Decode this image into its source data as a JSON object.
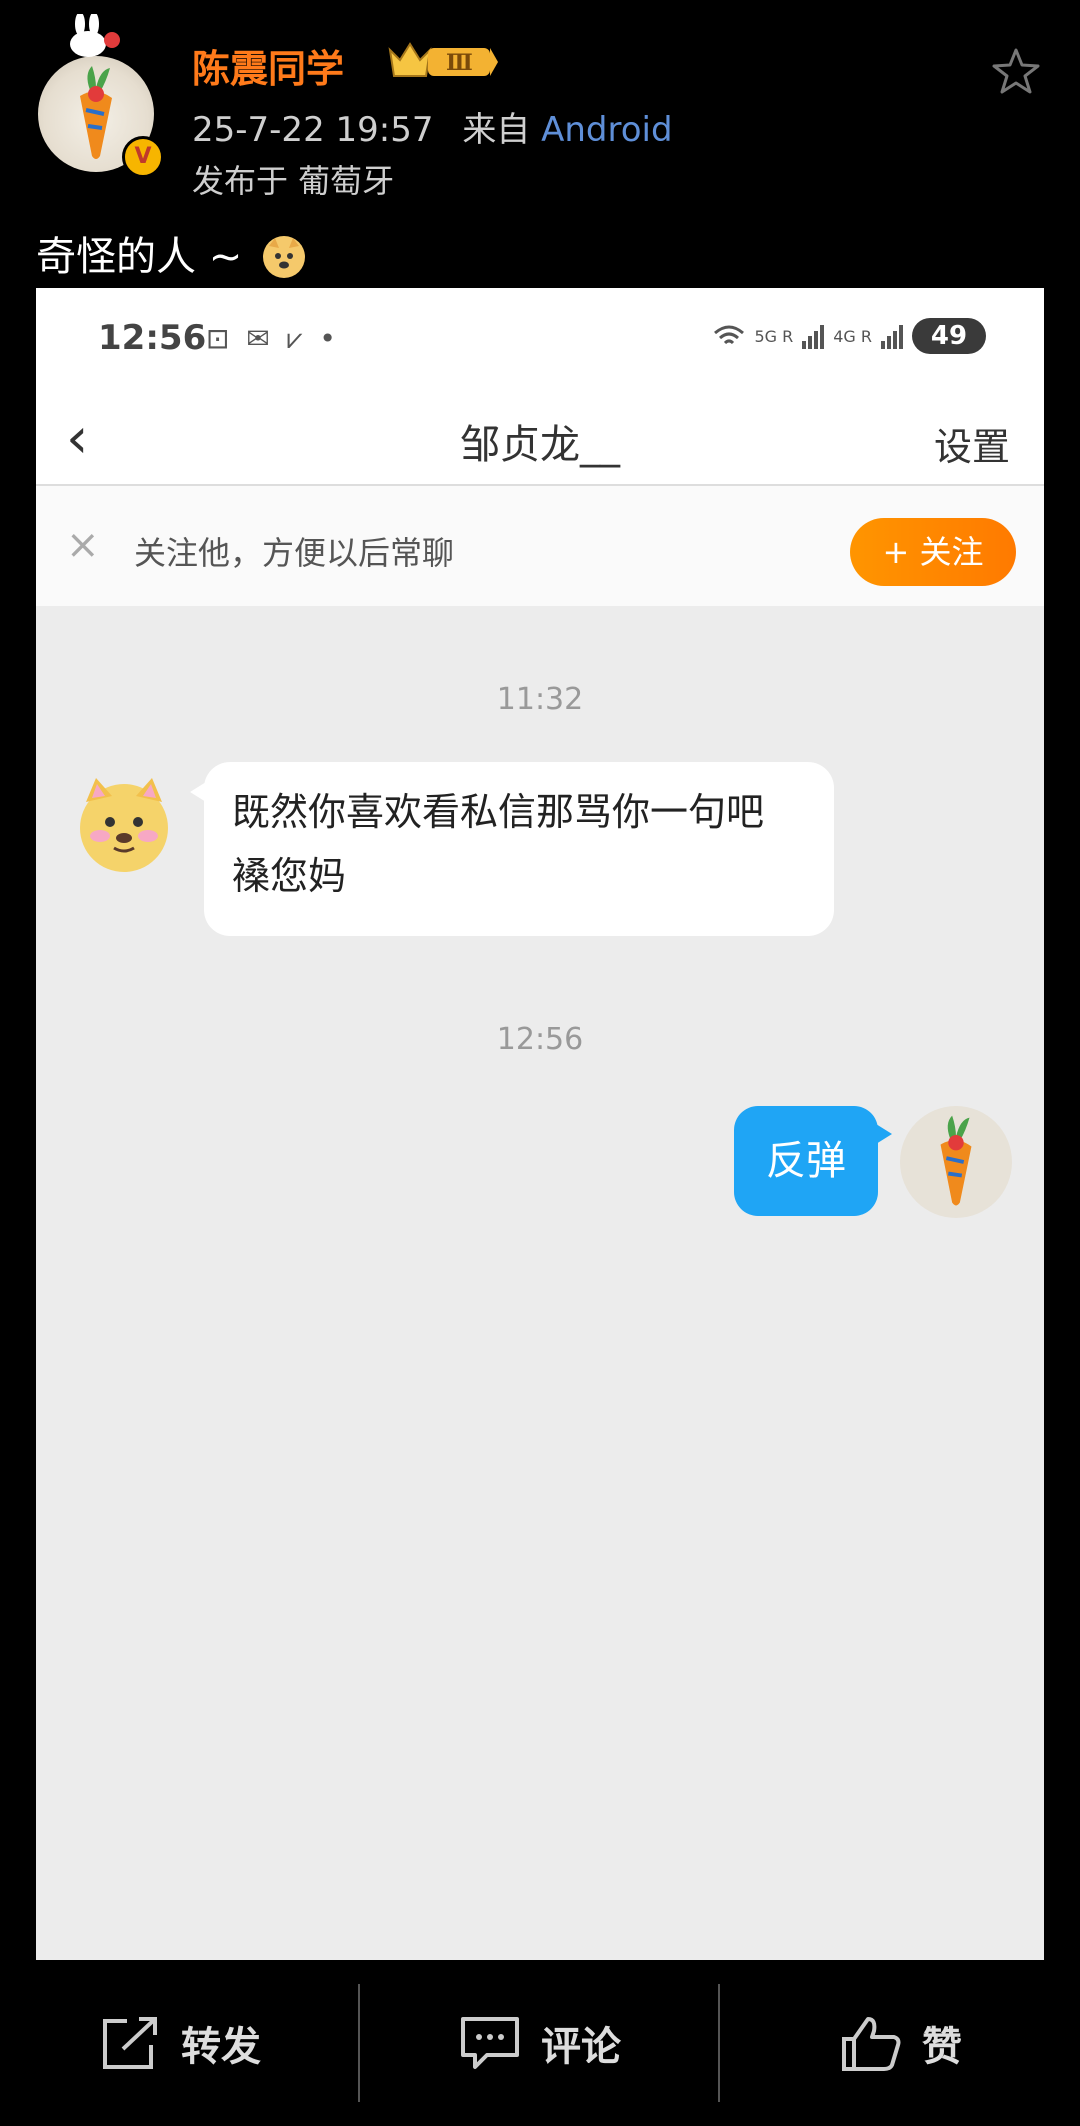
{
  "post": {
    "username": "陈震同学",
    "badge_level": "Ⅲ",
    "date_time": "25-7-22 19:57",
    "from_label": "来自",
    "source": "Android",
    "location": "发布于 葡萄牙",
    "caption": "奇怪的人 ~",
    "verified_mark": "V"
  },
  "shot": {
    "status_time": "12:56",
    "status_icons": "⊡ ✉ ⩗ •",
    "net_5g": "5G R",
    "net_4g": "4G R",
    "battery": "49",
    "back": "‹",
    "chat_title": "邹贞龙__",
    "settings": "设置",
    "follow_hint": "关注他，方便以后常聊",
    "follow_button": "+ 关注",
    "close": "×",
    "messages": [
      {
        "time": "11:32",
        "text": "既然你喜欢看私信那骂你一句吧 褬您妈",
        "side": "left"
      },
      {
        "time": "12:56",
        "text": "反弹",
        "side": "right"
      }
    ]
  },
  "actions": {
    "repost": "转发",
    "comment": "评论",
    "like": "赞"
  },
  "colors": {
    "username": "#ff7a1a",
    "source_link": "#5f8fd8",
    "follow_button": "#ff8a00",
    "my_bubble": "#1fa5f5"
  },
  "icons": [
    "star-icon",
    "verified-icon",
    "crown-badge-icon",
    "back-chevron-icon",
    "close-icon",
    "repost-icon",
    "comment-icon",
    "like-icon"
  ]
}
